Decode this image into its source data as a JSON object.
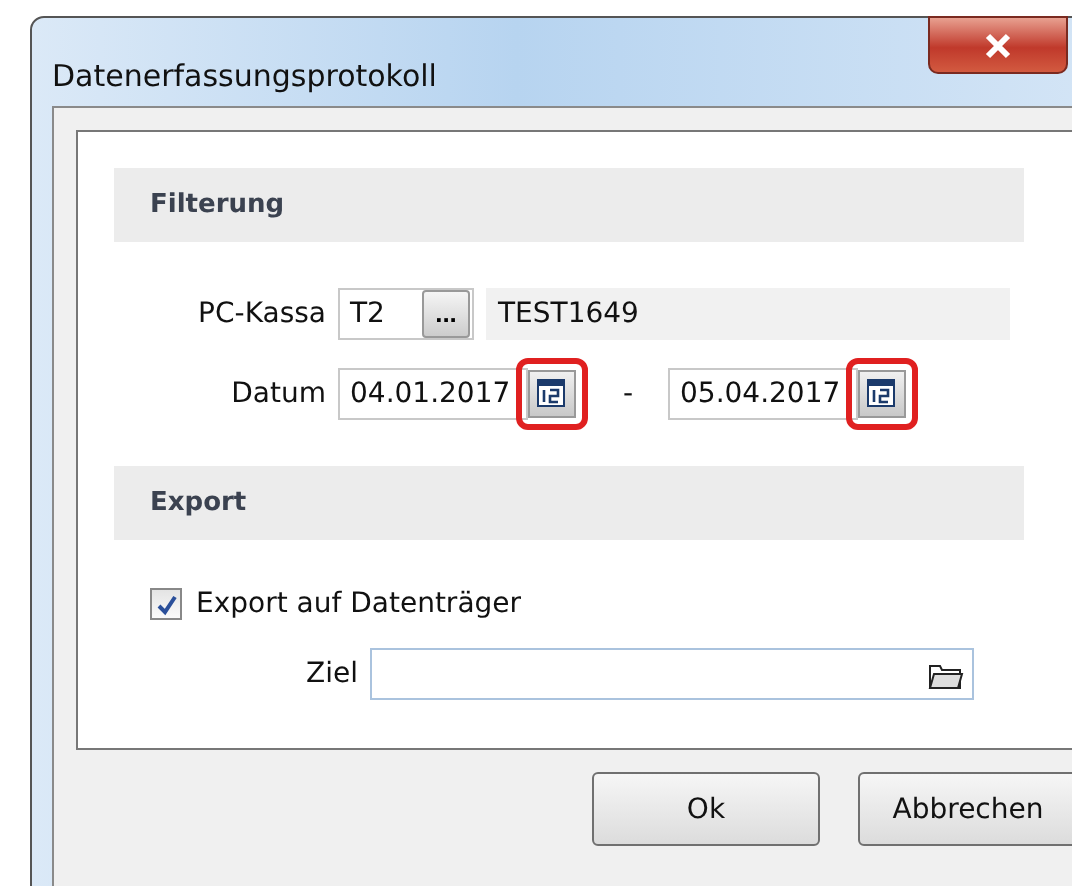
{
  "window": {
    "title": "Datenerfassungsprotokoll"
  },
  "filter": {
    "heading": "Filterung",
    "kasse": {
      "label": "PC-Kassa",
      "value": "T2",
      "browse": "...",
      "name": "TEST1649"
    },
    "date": {
      "label": "Datum",
      "from": "04.01.2017",
      "separator": "-",
      "to": "05.04.2017",
      "from_highlighted": true,
      "to_highlighted": true
    }
  },
  "export": {
    "heading": "Export",
    "checkbox": {
      "label": "Export auf Datenträger",
      "checked": true
    },
    "target": {
      "label": "Ziel"
    }
  },
  "buttons": [
    {
      "label": "Ok"
    },
    {
      "label": "Abbrechen"
    }
  ]
}
